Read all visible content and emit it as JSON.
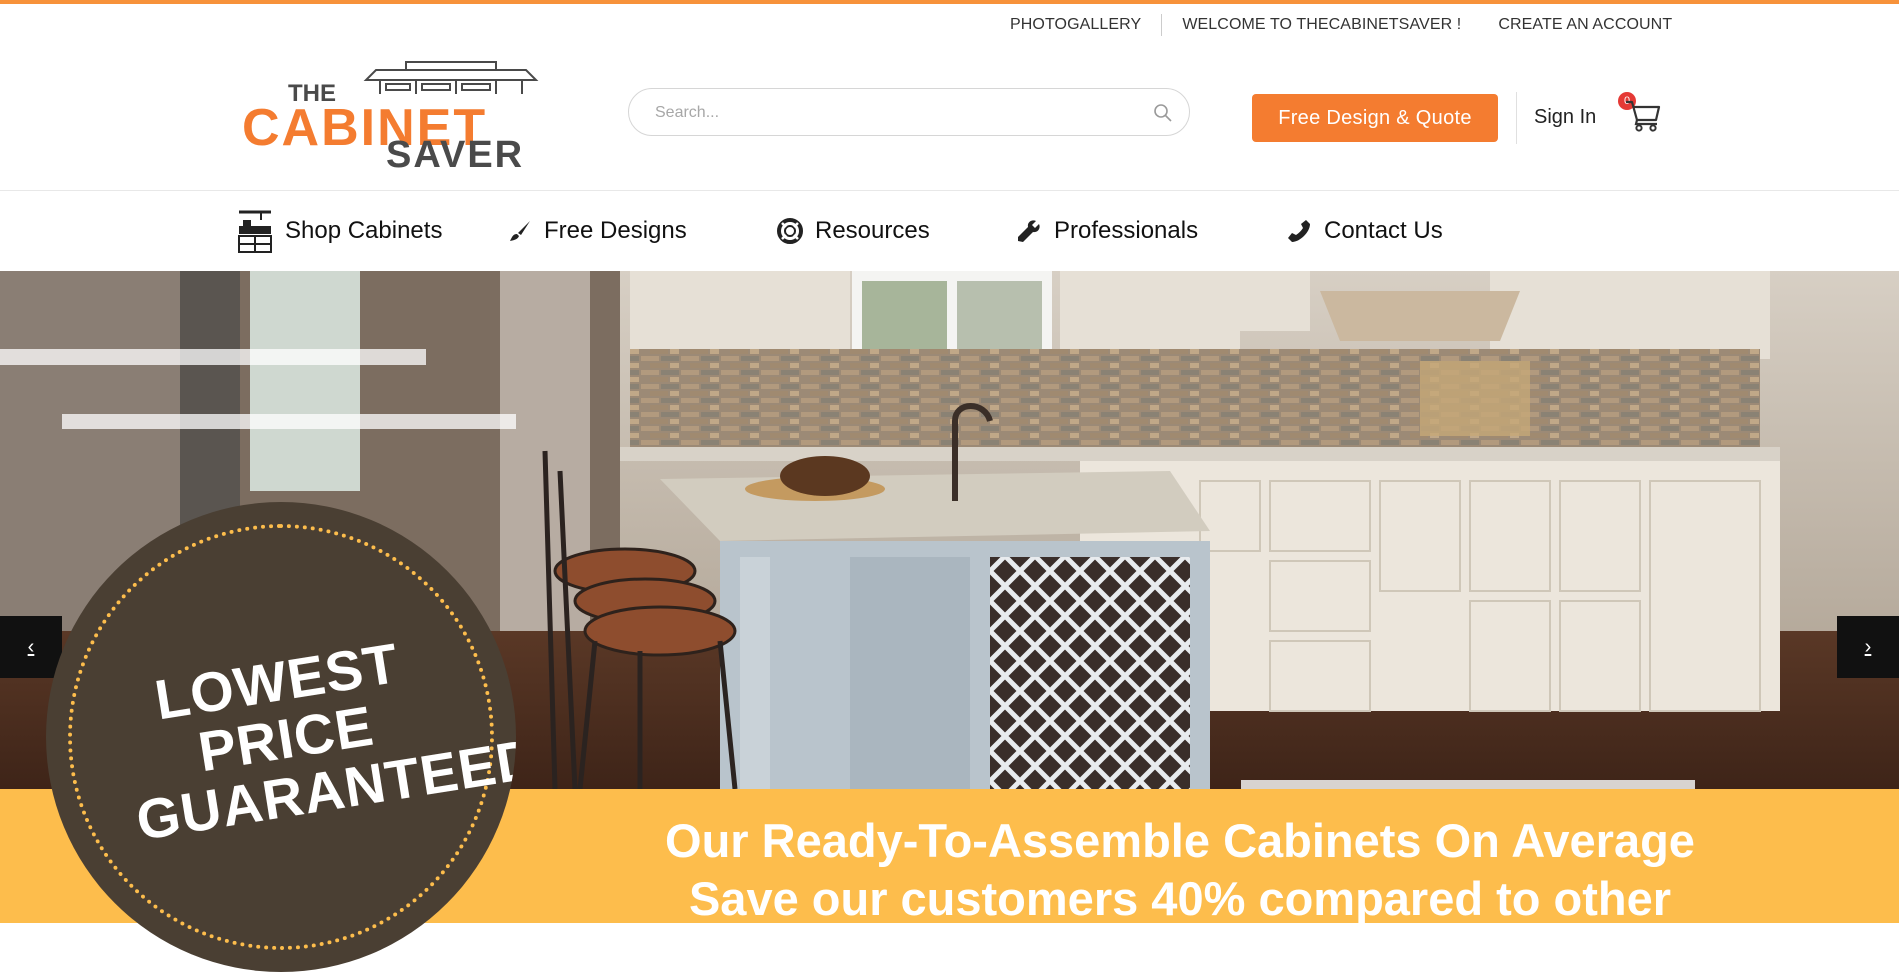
{
  "colors": {
    "accent": "#f47c30",
    "banner": "#fdbd4c",
    "seal": "#4a3f33"
  },
  "top_links": [
    "PHOTOGALLERY",
    "WELCOME TO THECABINETSAVER !",
    "CREATE AN ACCOUNT"
  ],
  "logo": {
    "line1": "THE",
    "line2": "CABINET",
    "line3": "SAVER"
  },
  "search": {
    "placeholder": "Search...",
    "icon": "search-icon"
  },
  "header": {
    "quote_label": "Free Design & Quote",
    "signin_label": "Sign In",
    "cart_count": "0",
    "cart_icon": "cart-icon"
  },
  "nav": [
    {
      "label": "Shop Cabinets",
      "icon": "cabinet-icon"
    },
    {
      "label": "Free Designs",
      "icon": "brush-icon"
    },
    {
      "label": "Resources",
      "icon": "lifebuoy-icon"
    },
    {
      "label": "Professionals",
      "icon": "wrench-icon"
    },
    {
      "label": "Contact Us",
      "icon": "phone-icon"
    }
  ],
  "hero": {
    "prev_label": "‹",
    "next_label": "›",
    "seal_lines": [
      "LOWEST",
      "PRICE",
      "GUARANTEED!"
    ]
  },
  "banner": {
    "line1": "Our Ready-To-Assemble Cabinets On Average",
    "line2": "Save our customers 40% compared to other"
  }
}
